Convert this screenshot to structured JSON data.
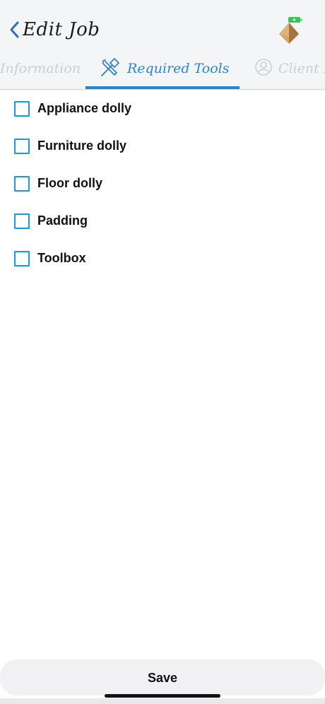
{
  "header": {
    "title": "Edit Job",
    "back_icon": "chevron-left-icon",
    "logo_icon": "pyramid-logo-icon",
    "battery_icon": "battery-charging-icon"
  },
  "tabs": [
    {
      "label": "Information",
      "active": false,
      "icon": ""
    },
    {
      "label": "Required Tools",
      "active": true,
      "icon": "tools-icon"
    },
    {
      "label": "Client In",
      "active": false,
      "icon": "user-icon"
    }
  ],
  "required_tools": [
    {
      "label": "Appliance dolly",
      "checked": false
    },
    {
      "label": "Furniture dolly",
      "checked": false
    },
    {
      "label": "Floor dolly",
      "checked": false
    },
    {
      "label": "Padding",
      "checked": false
    },
    {
      "label": "Toolbox",
      "checked": false
    }
  ],
  "footer": {
    "save_label": "Save"
  },
  "colors": {
    "accent": "#1f87d6",
    "checkbox_border": "#1a9ad6",
    "inactive_tab": "#c9ced9",
    "header_bg": "#f4f5f7"
  }
}
